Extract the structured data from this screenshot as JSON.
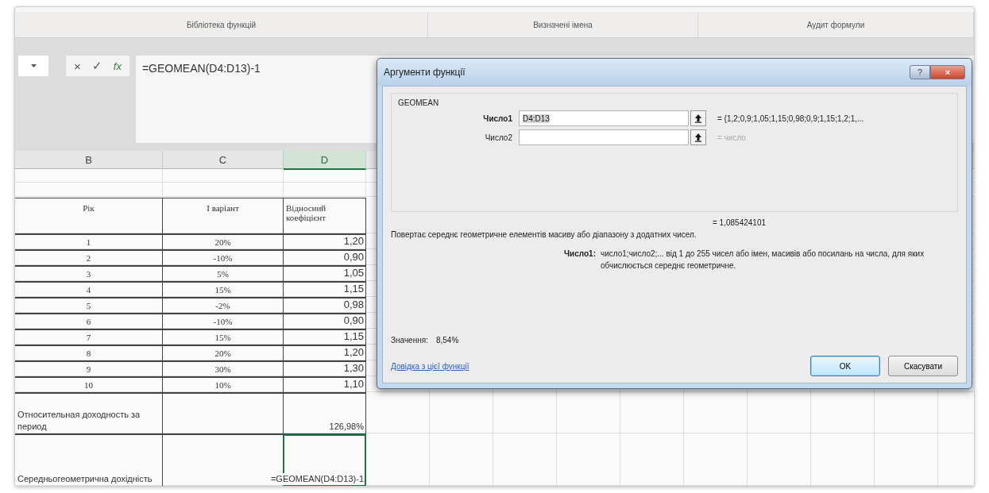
{
  "ribbon": {
    "groups": [
      {
        "label": "Бібліотека функцій"
      },
      {
        "label": "Визначені імена"
      },
      {
        "label": "Аудит формули"
      }
    ]
  },
  "formula_bar": {
    "cancel": "×",
    "enter": "✓",
    "function": "fx",
    "formula": "=GEOMEAN(D4:D13)-1"
  },
  "sheet": {
    "columns": [
      {
        "label": "B",
        "selected": false
      },
      {
        "label": "C",
        "selected": false
      },
      {
        "label": "D",
        "selected": true
      }
    ],
    "rows": [
      {
        "kind": "header",
        "selected": false,
        "cells": [
          "Рік",
          "I варіант",
          "Відносний коефіцієнт"
        ]
      },
      {
        "kind": "data",
        "selected": false,
        "cells": [
          "1",
          "20%",
          "1,20"
        ]
      },
      {
        "kind": "data",
        "selected": false,
        "cells": [
          "2",
          "-10%",
          "0,90"
        ]
      },
      {
        "kind": "data",
        "selected": false,
        "cells": [
          "3",
          "5%",
          "1,05"
        ]
      },
      {
        "kind": "data",
        "selected": false,
        "cells": [
          "4",
          "15%",
          "1,15"
        ]
      },
      {
        "kind": "data",
        "selected": false,
        "cells": [
          "5",
          "-2%",
          "0,98"
        ]
      },
      {
        "kind": "data",
        "selected": false,
        "cells": [
          "6",
          "-10%",
          "0,90"
        ]
      },
      {
        "kind": "data",
        "selected": false,
        "cells": [
          "7",
          "15%",
          "1,15"
        ]
      },
      {
        "kind": "data",
        "selected": false,
        "cells": [
          "8",
          "20%",
          "1,20"
        ]
      },
      {
        "kind": "data",
        "selected": false,
        "cells": [
          "9",
          "30%",
          "1,30"
        ]
      },
      {
        "kind": "data",
        "selected": false,
        "cells": [
          "10",
          "10%",
          "1,10"
        ]
      },
      {
        "kind": "summary",
        "selected": false,
        "cells": [
          "Относительная доходность за период",
          "",
          "126,98%"
        ]
      },
      {
        "kind": "summary",
        "selected": true,
        "cells": [
          "Середньогеометрична дохідність",
          "",
          "=GEOMEAN(D4:D13)-1"
        ]
      }
    ]
  },
  "dialog": {
    "title": "Аргументи функції",
    "help": "?",
    "close": "×",
    "function_name": "GEOMEAN",
    "arguments": [
      {
        "label": "Число1",
        "value": "D4:D13",
        "result": "= {1,2;0,9;1,05;1,15;0,98;0,9;1,15;1,2;1,...",
        "disabled": false
      },
      {
        "label": "Число2",
        "result": "= число",
        "disabled": true
      }
    ],
    "formula_result": "= 1,085424101",
    "description": "Повертає середнє геометричне елементів масиву або діапазону з додатних чисел.",
    "argument_help_label": "Число1:",
    "argument_help": "число1;число2;... від 1 до 255 чисел або імен, масивів або посилань на числа, для яких обчислюється середнє геометричне.",
    "value_label": "Значення:",
    "value": "8,54%",
    "help_link": "Довідка з цієї функції",
    "buttons": [
      {
        "label": "OK",
        "selected": true
      },
      {
        "label": "Скасувати",
        "selected": false
      }
    ]
  }
}
